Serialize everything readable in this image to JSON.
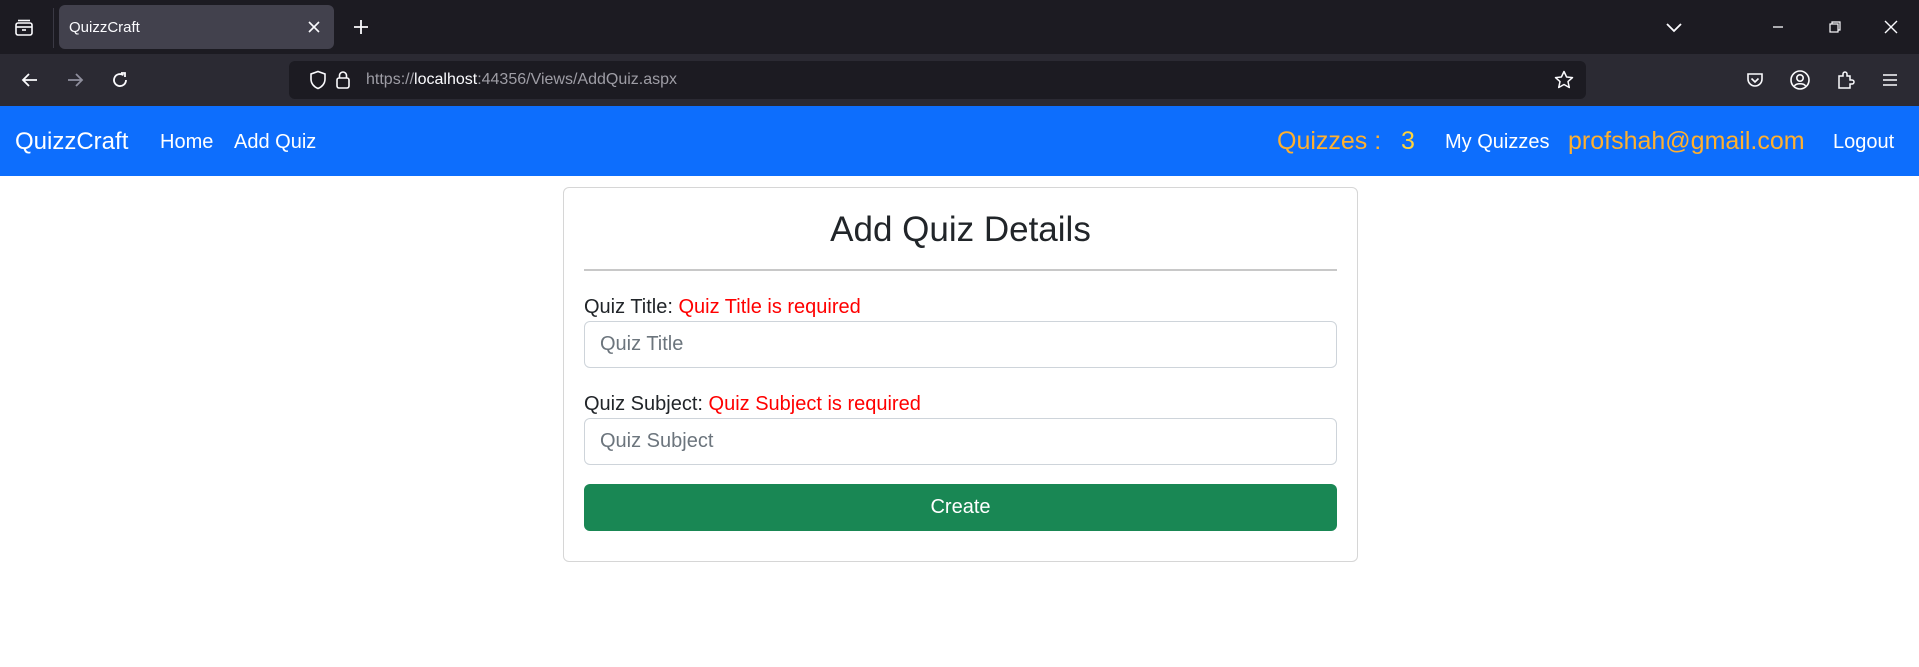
{
  "browser": {
    "tab_title": "QuizzCraft",
    "url_scheme": "https://",
    "url_host": "localhost",
    "url_rest": ":44356/Views/AddQuiz.aspx"
  },
  "navbar": {
    "brand": "QuizzCraft",
    "links": [
      "Home",
      "Add Quiz"
    ],
    "quiz_count_label": "Quizzes :",
    "quiz_count": "3",
    "my_quizzes": "My Quizzes",
    "user_email": "profshah@gmail.com",
    "logout": "Logout",
    "colors": {
      "bar": "#0d6efd",
      "count_label": "#ffb02e",
      "count": "#ffd43b"
    }
  },
  "form": {
    "title": "Add Quiz Details",
    "quiz_title_label": "Quiz Title:",
    "quiz_title_error": "Quiz Title is required",
    "quiz_title_placeholder": "Quiz Title",
    "quiz_subject_label": "Quiz Subject:",
    "quiz_subject_error": "Quiz Subject is required",
    "quiz_subject_placeholder": "Quiz Subject",
    "create_label": "Create",
    "colors": {
      "error": "#ff0000",
      "button": "#198754"
    }
  }
}
